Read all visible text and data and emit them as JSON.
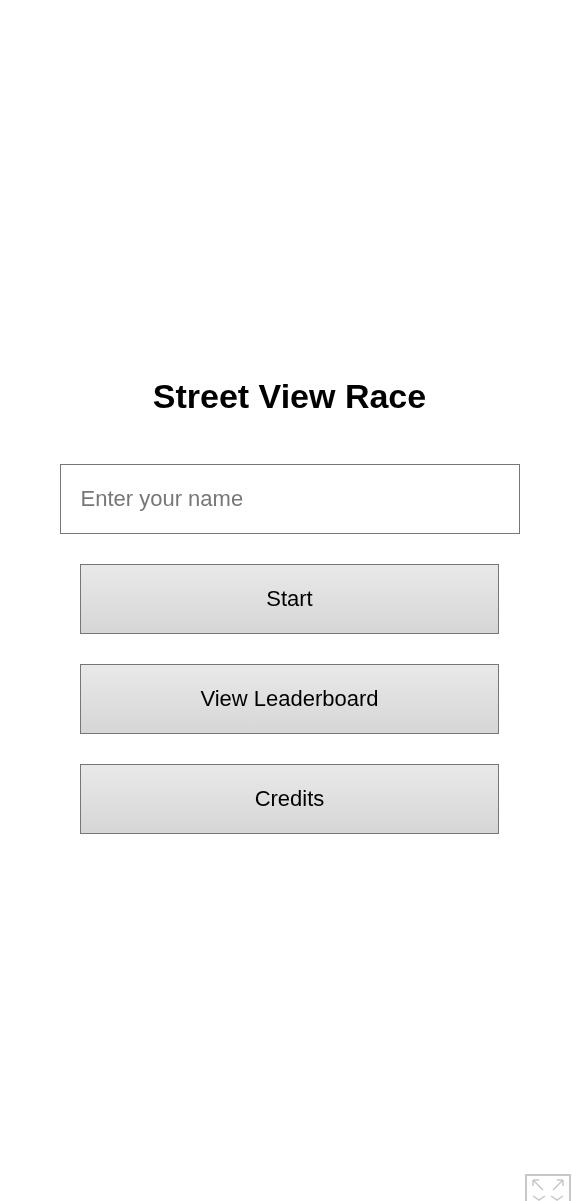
{
  "title": "Street View Race",
  "name_field": {
    "placeholder": "Enter your name"
  },
  "buttons": [
    "Start",
    "View Leaderboard",
    "Credits"
  ]
}
